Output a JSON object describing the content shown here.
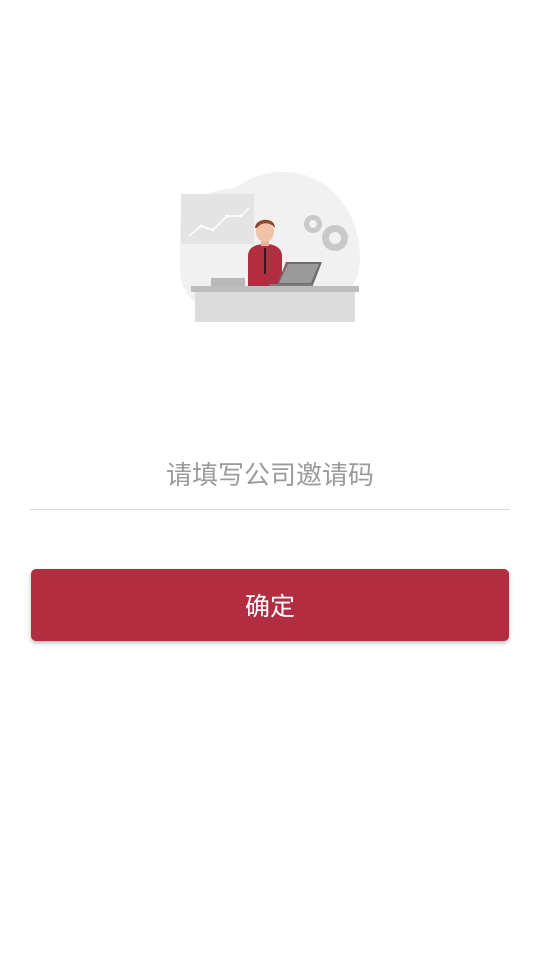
{
  "illustration": {
    "icon": "office-worker-at-laptop-illustration"
  },
  "invite": {
    "placeholder": "请填写公司邀请码",
    "value": ""
  },
  "actions": {
    "confirm_label": "确定"
  },
  "colors": {
    "primary": "#b32d40",
    "divider": "#dcdcdc",
    "placeholder": "#9b9b9b",
    "background": "#ffffff"
  }
}
